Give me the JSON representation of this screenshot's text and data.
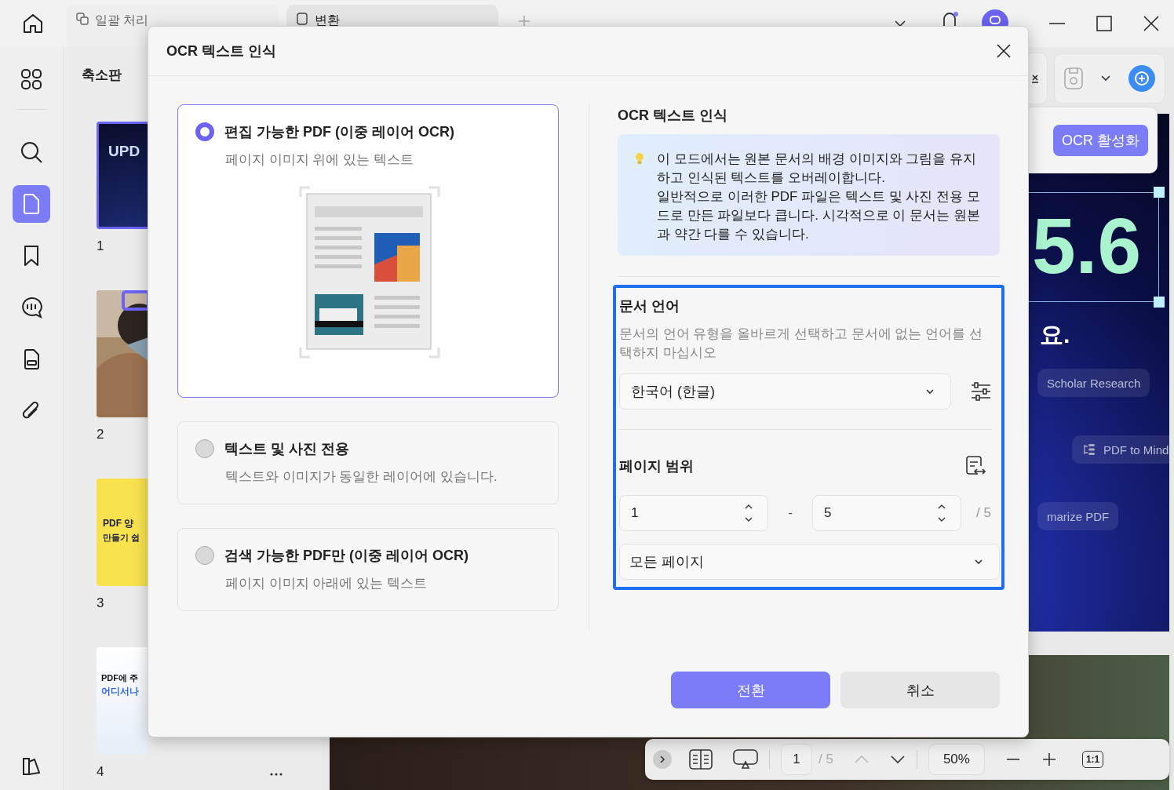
{
  "topbar": {
    "tabs": [
      {
        "label": "일괄 처리",
        "selected": false
      },
      {
        "label": "변환",
        "selected": true
      }
    ]
  },
  "rail": {
    "items": [
      {
        "kind": "grid",
        "selected": false
      },
      {
        "kind": "search",
        "selected": false
      },
      {
        "kind": "pages",
        "selected": true
      },
      {
        "kind": "bookmark",
        "selected": false
      },
      {
        "kind": "comment",
        "selected": false
      },
      {
        "kind": "form",
        "selected": false
      },
      {
        "kind": "attachment",
        "selected": false
      }
    ]
  },
  "thumbnails": {
    "title": "축소판",
    "pages": [
      {
        "number": "1",
        "kind": "cover",
        "texts": [
          "UPD"
        ]
      },
      {
        "number": "2",
        "kind": "picture"
      },
      {
        "number": "3",
        "kind": "yellow",
        "texts": [
          "PDF 양",
          "만들기 쉽"
        ]
      },
      {
        "number": "4",
        "kind": "flyer",
        "texts": [
          "PDF에 주",
          "어디서나"
        ]
      }
    ]
  },
  "document": {
    "ocr_button": "OCR 활성화",
    "headline": "5.6",
    "subline": "요.",
    "chips": [
      "Scholar Research",
      "PDF to Mind",
      "marize PDF"
    ]
  },
  "bottom_toolbar": {
    "page": "1",
    "total": "/ 5",
    "zoom": "50%",
    "fit": "1:1"
  },
  "dialog": {
    "title": "OCR 텍스트 인식",
    "options": [
      {
        "title": "편집 가능한 PDF (이중 레이어 OCR)",
        "description": "페이지 이미지 위에 있는 텍스트",
        "selected": true
      },
      {
        "title": "텍스트 및 사진 전용",
        "description": "텍스트와 이미지가 동일한 레이어에 있습니다.",
        "selected": false
      },
      {
        "title": "검색 가능한 PDF만 (이중 레이어 OCR)",
        "description": "페이지 이미지 아래에 있는 텍스트",
        "selected": false
      }
    ],
    "heading": "OCR 텍스트 인식",
    "info": [
      "이 모드에서는 원본 문서의 배경 이미지와 그림을 유지하고 인식된 텍스트를 오버레이합니다.",
      "일반적으로 이러한 PDF 파일은 텍스트 및 사진 전용 모드로 만든 파일보다 큽니다. 시각적으로 이 문서는 원본과 약간 다를 수 있습니다."
    ],
    "language": {
      "label": "문서 언어",
      "description": "문서의 언어 유형을 올바르게 선택하고 문서에 없는 언어를 선택하지 마십시오",
      "value": "한국어 (한글)"
    },
    "range": {
      "label": "페이지 범위",
      "from": "1",
      "separator": "-",
      "to": "5",
      "total": "/ 5",
      "scope": "모든 페이지"
    },
    "buttons": {
      "confirm": "전환",
      "cancel": "취소"
    }
  }
}
